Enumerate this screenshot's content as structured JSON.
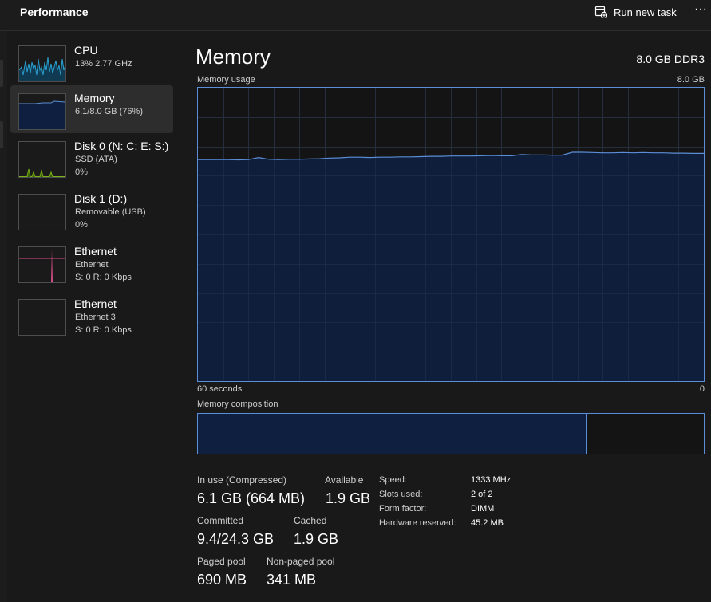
{
  "header": {
    "title": "Performance",
    "run_new_task_label": "Run new task",
    "more_label": "···",
    "run_icon": "run-new-task-icon"
  },
  "sidebar": {
    "items": [
      {
        "name": "CPU",
        "lines": [
          "13% 2.77 GHz"
        ],
        "graph_color": "#2aa1d3",
        "selected": false
      },
      {
        "name": "Memory",
        "lines": [
          "6.1/8.0 GB (76%)"
        ],
        "graph_color": "#5b8ed6",
        "selected": true
      },
      {
        "name": "Disk 0 (N: C: E: S:)",
        "lines": [
          "SSD (ATA)",
          "0%"
        ],
        "graph_color": "#7ab317",
        "selected": false
      },
      {
        "name": "Disk 1 (D:)",
        "lines": [
          "Removable (USB)",
          "0%"
        ],
        "graph_color": "#7ab317",
        "selected": false
      },
      {
        "name": "Ethernet",
        "lines": [
          "Ethernet",
          "S: 0 R: 0 Kbps"
        ],
        "graph_color": "#d94f8a",
        "selected": false
      },
      {
        "name": "Ethernet",
        "lines": [
          "Ethernet 3",
          "S: 0 R: 0 Kbps"
        ],
        "graph_color": "#d94f8a",
        "selected": false
      }
    ]
  },
  "main": {
    "title": "Memory",
    "spec": "8.0 GB DDR3",
    "usage_label": "Memory usage",
    "usage_max": "8.0 GB",
    "time_label": "60 seconds",
    "time_end": "0",
    "composition_label": "Memory composition",
    "composition": {
      "in_use_fraction": 0.767,
      "accent": "#5b8ed6",
      "fill": "#0f1f3f"
    },
    "usage_history_percent": [
      75.5,
      75.5,
      75.5,
      75.5,
      75.4,
      75.5,
      76.2,
      75.6,
      75.5,
      75.6,
      75.6,
      75.7,
      75.8,
      76.0,
      76.1,
      76.3,
      76.3,
      76.2,
      76.3,
      76.3,
      76.4,
      76.4,
      76.5,
      76.6,
      76.6,
      76.7,
      76.7,
      76.7,
      76.8,
      76.9,
      76.8,
      76.8,
      77.2,
      77.1,
      77.1,
      77.0,
      77.0,
      78.0,
      78.0,
      77.9,
      77.8,
      77.8,
      77.9,
      77.8,
      77.9,
      77.8,
      77.8,
      77.7,
      77.7,
      77.6,
      77.6
    ]
  },
  "stats": {
    "in_use_label": "In use (Compressed)",
    "in_use_value": "6.1 GB (664 MB)",
    "available_label": "Available",
    "available_value": "1.9 GB",
    "committed_label": "Committed",
    "committed_value": "9.4/24.3 GB",
    "cached_label": "Cached",
    "cached_value": "1.9 GB",
    "paged_label": "Paged pool",
    "paged_value": "690 MB",
    "nonpaged_label": "Non-paged pool",
    "nonpaged_value": "341 MB"
  },
  "specs": [
    {
      "label": "Speed:",
      "value": "1333 MHz"
    },
    {
      "label": "Slots used:",
      "value": "2 of 2"
    },
    {
      "label": "Form factor:",
      "value": "DIMM"
    },
    {
      "label": "Hardware reserved:",
      "value": "45.2 MB"
    }
  ]
}
